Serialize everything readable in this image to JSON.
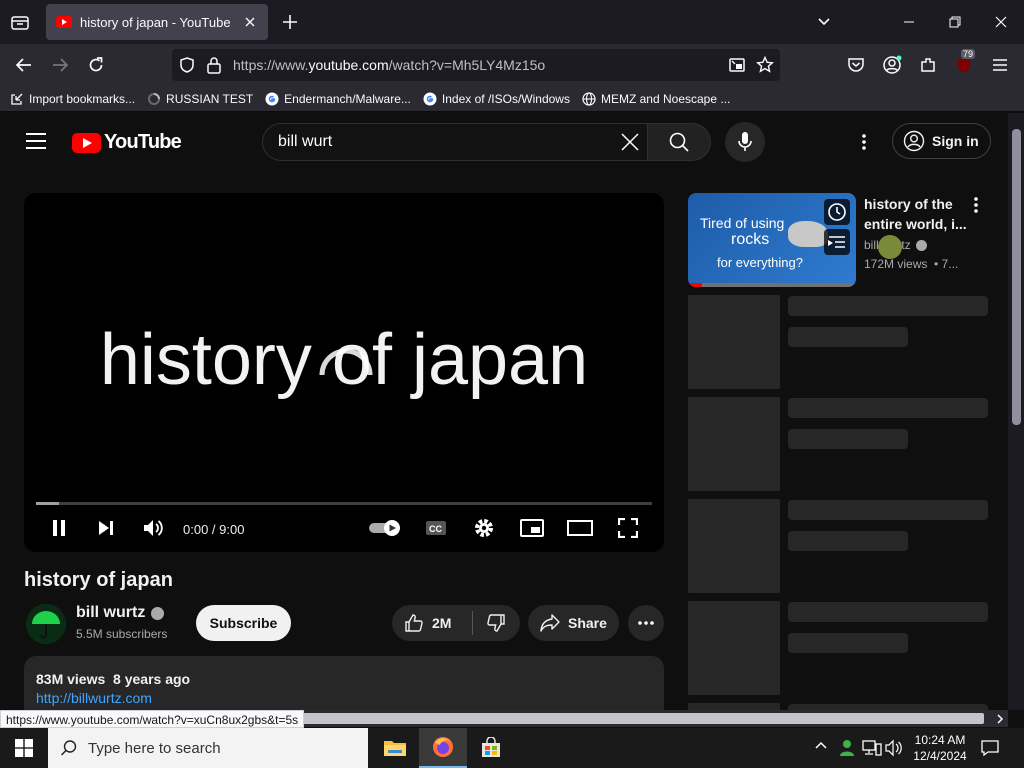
{
  "browser": {
    "tab_title": "history of japan - YouTube",
    "url_prefix": "https://www.",
    "url_host": "youtube.com",
    "url_path": "/watch?v=Mh5LY4Mz15o",
    "extensions_badge": "79",
    "bookmarks": [
      {
        "label": "Import bookmarks...",
        "icon": "import-icon"
      },
      {
        "label": "RUSSIAN TEST",
        "icon": "loading-icon"
      },
      {
        "label": "Endermanch/Malware...",
        "icon": "google-icon"
      },
      {
        "label": "Index of /ISOs/Windows",
        "icon": "google-icon"
      },
      {
        "label": "MEMZ and Noescape ...",
        "icon": "globe-icon"
      }
    ],
    "status_url": "https://www.youtube.com/watch?v=xuCn8ux2gbs&t=5s"
  },
  "youtube": {
    "logo_text": "YouTube",
    "search_value": "bill wurt",
    "signin_label": "Sign in",
    "player": {
      "frame_text": "history of japan",
      "time": "0:00 / 9:00",
      "progress_fraction": 0.0
    },
    "video": {
      "title": "history of japan",
      "channel": "bill wurtz",
      "subscribers": "5.5M subscribers",
      "subscribe_label": "Subscribe",
      "likes": "2M",
      "share_label": "Share",
      "views_date": "83M views  8 years ago",
      "link": "http://billwurtz.com"
    },
    "recommendation": {
      "thumb_line1": "Tired of using",
      "thumb_line2": "rocks",
      "thumb_line3": "for everything?",
      "title": "history of the entire world, i...",
      "channel": "bill wurtz",
      "meta": "172M views  • 7..."
    }
  },
  "taskbar": {
    "search_placeholder": "Type here to search",
    "time": "10:24 AM",
    "date": "12/4/2024"
  },
  "colors": {
    "youtube_red": "#ff0000",
    "link_blue": "#3ea6ff",
    "page_bg": "#0f0f0f"
  }
}
